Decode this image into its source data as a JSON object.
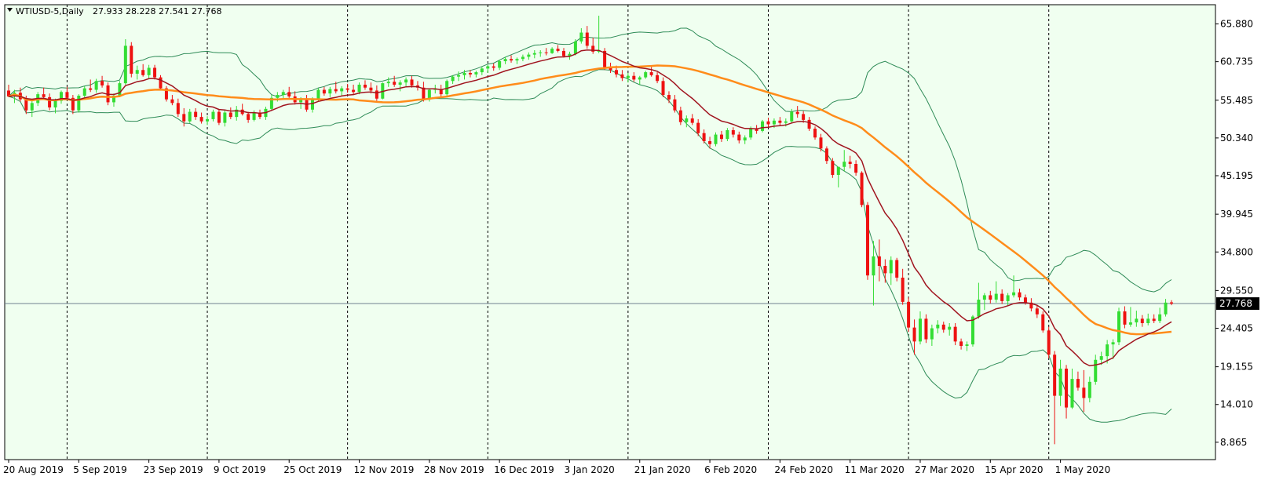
{
  "header": {
    "symbol_timeframe": "WTIUSD-5,Daily",
    "ohlc": "27.933 28.228 27.541 27.768"
  },
  "colors": {
    "background": "#f0fff0",
    "grid": "#000000",
    "bull": "#33dd33",
    "bear": "#ee1111",
    "ma_fast": "#a0141e",
    "ma_slow": "#ff8c1a",
    "bollinger": "#2e8b57",
    "current_price_line": "#708090",
    "price_label_bg": "#000000"
  },
  "chart_data": {
    "type": "candlestick",
    "title": "WTIUSD-5,Daily",
    "ylim": [
      6.5,
      68.5
    ],
    "yticks": [
      "65.880",
      "60.735",
      "55.485",
      "50.340",
      "45.195",
      "39.945",
      "34.800",
      "29.550",
      "24.405",
      "19.155",
      "14.010",
      "8.865"
    ],
    "ytick_values": [
      65.88,
      60.735,
      55.485,
      50.34,
      45.195,
      39.945,
      34.8,
      29.55,
      24.405,
      19.155,
      14.01,
      8.865
    ],
    "xticks": [
      "20 Aug 2019",
      "5 Sep 2019",
      "23 Sep 2019",
      "9 Oct 2019",
      "25 Oct 2019",
      "12 Nov 2019",
      "28 Nov 2019",
      "16 Dec 2019",
      "3 Jan 2020",
      "21 Jan 2020",
      "6 Feb 2020",
      "24 Feb 2020",
      "11 Mar 2020",
      "27 Mar 2020",
      "15 Apr 2020",
      "1 May 2020"
    ],
    "xtick_index": [
      0,
      12,
      24,
      36,
      48,
      60,
      72,
      84,
      96,
      108,
      120,
      132,
      144,
      156,
      168,
      180
    ],
    "separators_index": [
      10,
      34,
      58,
      82,
      106,
      130,
      154,
      178
    ],
    "current_price": 27.768,
    "current_price_label": "27.768",
    "candles": [
      [
        56.8,
        57.6,
        55.9,
        56.0
      ],
      [
        56.0,
        56.9,
        55.1,
        56.5
      ],
      [
        56.5,
        57.2,
        55.3,
        55.6
      ],
      [
        55.6,
        56.1,
        53.6,
        54.1
      ],
      [
        54.1,
        55.4,
        53.2,
        55.1
      ],
      [
        55.1,
        56.6,
        54.7,
        56.3
      ],
      [
        56.3,
        57.2,
        55.6,
        55.9
      ],
      [
        55.9,
        56.4,
        54.1,
        54.5
      ],
      [
        54.5,
        55.7,
        53.7,
        55.4
      ],
      [
        55.4,
        56.8,
        55.0,
        56.6
      ],
      [
        56.6,
        57.3,
        55.5,
        55.8
      ],
      [
        55.8,
        56.2,
        53.6,
        54.1
      ],
      [
        54.1,
        56.3,
        53.8,
        56.1
      ],
      [
        56.1,
        57.4,
        55.7,
        57.1
      ],
      [
        57.1,
        58.3,
        56.6,
        56.9
      ],
      [
        56.9,
        58.4,
        56.5,
        58.1
      ],
      [
        58.1,
        58.8,
        57.2,
        57.5
      ],
      [
        57.5,
        57.9,
        54.8,
        55.2
      ],
      [
        55.2,
        56.4,
        54.6,
        56.1
      ],
      [
        56.1,
        58.1,
        55.9,
        57.8
      ],
      [
        57.8,
        63.8,
        57.6,
        62.9
      ],
      [
        62.9,
        63.4,
        58.6,
        59.1
      ],
      [
        59.1,
        60.2,
        58.3,
        59.6
      ],
      [
        59.6,
        60.4,
        58.7,
        58.9
      ],
      [
        58.9,
        60.3,
        58.4,
        59.9
      ],
      [
        59.9,
        60.3,
        58.3,
        58.6
      ],
      [
        58.6,
        58.9,
        56.8,
        57.1
      ],
      [
        57.1,
        57.4,
        55.3,
        55.6
      ],
      [
        55.6,
        56.2,
        54.8,
        55.1
      ],
      [
        55.1,
        55.7,
        53.2,
        53.6
      ],
      [
        53.6,
        54.4,
        51.9,
        52.6
      ],
      [
        52.6,
        54.3,
        52.4,
        53.9
      ],
      [
        53.9,
        54.4,
        52.8,
        53.2
      ],
      [
        53.2,
        53.8,
        52.3,
        52.6
      ],
      [
        52.6,
        53.3,
        52.1,
        52.9
      ],
      [
        52.9,
        54.2,
        52.6,
        53.9
      ],
      [
        53.9,
        54.3,
        52.1,
        52.4
      ],
      [
        52.4,
        54.1,
        51.9,
        53.8
      ],
      [
        53.8,
        54.5,
        52.9,
        53.2
      ],
      [
        53.2,
        54.7,
        52.7,
        54.2
      ],
      [
        54.2,
        55.0,
        53.4,
        53.6
      ],
      [
        53.6,
        53.9,
        52.4,
        52.8
      ],
      [
        52.8,
        54.1,
        52.6,
        53.8
      ],
      [
        53.8,
        54.2,
        52.9,
        53.2
      ],
      [
        53.2,
        54.6,
        52.8,
        54.3
      ],
      [
        54.3,
        56.2,
        54.1,
        55.8
      ],
      [
        55.8,
        56.6,
        55.3,
        56.2
      ],
      [
        56.2,
        56.9,
        55.6,
        56.6
      ],
      [
        56.6,
        57.3,
        55.8,
        56.0
      ],
      [
        56.0,
        56.7,
        54.9,
        55.2
      ],
      [
        55.2,
        55.9,
        54.3,
        55.5
      ],
      [
        55.5,
        56.2,
        53.9,
        54.2
      ],
      [
        54.2,
        55.9,
        53.8,
        55.6
      ],
      [
        55.6,
        57.1,
        55.3,
        56.9
      ],
      [
        56.9,
        57.3,
        56.1,
        56.4
      ],
      [
        56.4,
        57.3,
        55.9,
        57.0
      ],
      [
        57.0,
        58.0,
        56.4,
        56.7
      ],
      [
        56.7,
        57.4,
        56.0,
        57.1
      ],
      [
        57.1,
        57.7,
        56.5,
        56.9
      ],
      [
        56.9,
        57.6,
        56.2,
        56.6
      ],
      [
        56.6,
        57.9,
        56.3,
        57.6
      ],
      [
        57.6,
        58.2,
        56.9,
        57.2
      ],
      [
        57.2,
        57.9,
        56.4,
        56.8
      ],
      [
        56.8,
        57.5,
        55.4,
        55.7
      ],
      [
        55.7,
        57.9,
        55.6,
        57.8
      ],
      [
        57.8,
        58.6,
        57.3,
        58.0
      ],
      [
        58.0,
        58.8,
        57.3,
        57.6
      ],
      [
        57.6,
        58.2,
        56.7,
        57.9
      ],
      [
        57.9,
        58.6,
        57.4,
        58.3
      ],
      [
        58.3,
        58.8,
        57.2,
        57.5
      ],
      [
        57.5,
        58.1,
        56.8,
        57.2
      ],
      [
        57.2,
        58.0,
        55.3,
        55.6
      ],
      [
        55.6,
        57.1,
        55.3,
        56.9
      ],
      [
        56.9,
        57.6,
        56.4,
        57.0
      ],
      [
        57.0,
        57.6,
        55.9,
        56.3
      ],
      [
        56.3,
        58.3,
        56.0,
        58.1
      ],
      [
        58.1,
        58.9,
        57.7,
        58.7
      ],
      [
        58.7,
        59.4,
        58.1,
        58.9
      ],
      [
        58.9,
        59.6,
        58.3,
        59.2
      ],
      [
        59.2,
        59.6,
        58.6,
        59.0
      ],
      [
        59.0,
        59.5,
        58.6,
        59.3
      ],
      [
        59.3,
        60.0,
        58.9,
        59.8
      ],
      [
        59.8,
        60.3,
        59.2,
        60.1
      ],
      [
        60.1,
        60.5,
        59.5,
        59.9
      ],
      [
        59.9,
        61.0,
        59.6,
        60.8
      ],
      [
        60.8,
        61.4,
        60.4,
        61.1
      ],
      [
        61.1,
        61.6,
        60.6,
        60.9
      ],
      [
        60.9,
        61.3,
        60.4,
        61.1
      ],
      [
        61.1,
        61.7,
        60.8,
        61.4
      ],
      [
        61.4,
        62.0,
        61.0,
        61.7
      ],
      [
        61.7,
        62.3,
        61.2,
        61.9
      ],
      [
        61.9,
        62.3,
        61.4,
        62.0
      ],
      [
        62.0,
        62.6,
        61.6,
        61.9
      ],
      [
        61.9,
        62.7,
        61.8,
        62.5
      ],
      [
        62.5,
        63.0,
        62.0,
        62.2
      ],
      [
        62.2,
        62.6,
        61.3,
        61.5
      ],
      [
        61.5,
        62.1,
        61.0,
        61.8
      ],
      [
        61.8,
        63.8,
        61.6,
        63.5
      ],
      [
        63.5,
        65.3,
        63.2,
        64.7
      ],
      [
        64.7,
        65.6,
        62.5,
        62.9
      ],
      [
        62.9,
        64.0,
        61.8,
        62.1
      ],
      [
        62.1,
        67.0,
        61.9,
        62.2
      ],
      [
        62.2,
        62.6,
        59.6,
        60.0
      ],
      [
        60.0,
        60.6,
        59.2,
        59.6
      ],
      [
        59.6,
        60.2,
        58.6,
        59.0
      ],
      [
        59.0,
        59.6,
        58.1,
        58.5
      ],
      [
        58.5,
        59.2,
        57.9,
        58.8
      ],
      [
        58.8,
        59.3,
        58.0,
        58.3
      ],
      [
        58.3,
        58.8,
        57.6,
        58.6
      ],
      [
        58.6,
        59.5,
        58.4,
        59.3
      ],
      [
        59.3,
        60.0,
        58.7,
        58.9
      ],
      [
        58.9,
        59.3,
        57.8,
        58.1
      ],
      [
        58.1,
        58.6,
        55.9,
        56.2
      ],
      [
        56.2,
        56.7,
        55.1,
        55.6
      ],
      [
        55.6,
        56.2,
        53.8,
        54.1
      ],
      [
        54.1,
        54.6,
        52.1,
        52.5
      ],
      [
        52.5,
        53.4,
        51.8,
        53.0
      ],
      [
        53.0,
        53.6,
        52.1,
        52.4
      ],
      [
        52.4,
        52.9,
        50.6,
        51.0
      ],
      [
        51.0,
        51.5,
        49.6,
        49.9
      ],
      [
        49.9,
        50.5,
        48.9,
        49.5
      ],
      [
        49.5,
        51.1,
        49.2,
        50.8
      ],
      [
        50.8,
        51.3,
        49.8,
        50.2
      ],
      [
        50.2,
        51.7,
        49.9,
        51.4
      ],
      [
        51.4,
        51.8,
        50.4,
        50.8
      ],
      [
        50.8,
        51.2,
        49.6,
        50.0
      ],
      [
        50.0,
        50.7,
        49.5,
        50.4
      ],
      [
        50.4,
        51.9,
        50.1,
        51.6
      ],
      [
        51.6,
        52.1,
        50.9,
        51.3
      ],
      [
        51.3,
        52.8,
        51.1,
        52.6
      ],
      [
        52.6,
        53.1,
        51.8,
        52.2
      ],
      [
        52.2,
        53.0,
        51.7,
        52.7
      ],
      [
        52.7,
        53.2,
        52.0,
        52.4
      ],
      [
        52.4,
        53.0,
        51.9,
        52.6
      ],
      [
        52.6,
        54.3,
        52.4,
        53.9
      ],
      [
        53.9,
        54.7,
        53.1,
        53.6
      ],
      [
        53.6,
        54.0,
        52.4,
        52.8
      ],
      [
        52.8,
        53.2,
        51.3,
        51.6
      ],
      [
        51.6,
        51.9,
        50.1,
        50.4
      ],
      [
        50.4,
        50.9,
        48.5,
        48.9
      ],
      [
        48.9,
        49.2,
        46.8,
        47.2
      ],
      [
        47.2,
        47.6,
        44.9,
        45.3
      ],
      [
        45.3,
        46.1,
        43.6,
        46.4
      ],
      [
        46.4,
        48.7,
        45.8,
        47.1
      ],
      [
        47.1,
        47.9,
        46.2,
        46.8
      ],
      [
        46.8,
        47.3,
        45.2,
        45.6
      ],
      [
        45.6,
        45.8,
        40.9,
        41.2
      ],
      [
        41.2,
        41.6,
        31.0,
        31.6
      ],
      [
        31.6,
        36.3,
        27.5,
        34.2
      ],
      [
        34.2,
        36.5,
        30.8,
        32.9
      ],
      [
        32.9,
        33.8,
        30.6,
        31.9
      ],
      [
        31.9,
        34.2,
        30.3,
        33.7
      ],
      [
        33.7,
        34.0,
        30.8,
        31.3
      ],
      [
        31.3,
        32.5,
        27.6,
        28.0
      ],
      [
        28.0,
        28.6,
        23.9,
        24.5
      ],
      [
        24.5,
        25.6,
        20.8,
        22.6
      ],
      [
        22.6,
        26.7,
        22.2,
        25.7
      ],
      [
        25.7,
        26.3,
        22.4,
        22.9
      ],
      [
        22.9,
        24.9,
        22.0,
        24.4
      ],
      [
        24.4,
        25.5,
        23.7,
        24.9
      ],
      [
        24.9,
        25.3,
        23.8,
        24.2
      ],
      [
        24.2,
        25.1,
        23.4,
        24.6
      ],
      [
        24.6,
        25.1,
        22.1,
        22.6
      ],
      [
        22.6,
        23.0,
        21.5,
        22.0
      ],
      [
        22.0,
        22.6,
        21.3,
        22.2
      ],
      [
        22.2,
        26.2,
        21.9,
        26.0
      ],
      [
        26.0,
        30.6,
        25.7,
        28.3
      ],
      [
        28.3,
        29.2,
        26.9,
        28.9
      ],
      [
        28.9,
        29.5,
        27.8,
        28.3
      ],
      [
        28.3,
        30.8,
        27.9,
        29.1
      ],
      [
        29.1,
        29.7,
        27.7,
        28.1
      ],
      [
        28.1,
        29.2,
        27.4,
        28.9
      ],
      [
        28.9,
        31.6,
        28.6,
        29.3
      ],
      [
        29.3,
        29.8,
        28.2,
        28.6
      ],
      [
        28.6,
        29.0,
        27.6,
        27.9
      ],
      [
        27.9,
        28.5,
        26.7,
        27.1
      ],
      [
        27.1,
        27.6,
        25.8,
        26.3
      ],
      [
        26.3,
        26.7,
        23.8,
        24.1
      ],
      [
        24.1,
        24.6,
        20.3,
        20.8
      ],
      [
        20.8,
        21.3,
        8.6,
        15.2
      ],
      [
        15.2,
        20.1,
        13.8,
        18.9
      ],
      [
        18.9,
        19.4,
        12.1,
        13.6
      ],
      [
        13.6,
        18.9,
        13.4,
        17.5
      ],
      [
        17.5,
        18.5,
        15.9,
        16.3
      ],
      [
        16.3,
        18.7,
        13.0,
        14.9
      ],
      [
        14.9,
        17.8,
        14.3,
        17.1
      ],
      [
        17.1,
        20.8,
        16.7,
        20.1
      ],
      [
        20.1,
        21.2,
        19.4,
        20.6
      ],
      [
        20.6,
        22.8,
        19.6,
        22.2
      ],
      [
        22.2,
        22.9,
        20.2,
        22.5
      ],
      [
        22.5,
        27.2,
        22.1,
        26.7
      ],
      [
        26.7,
        27.4,
        24.4,
        24.9
      ],
      [
        24.9,
        27.3,
        24.6,
        25.2
      ],
      [
        25.2,
        26.8,
        24.6,
        25.7
      ],
      [
        25.7,
        26.2,
        24.6,
        25.1
      ],
      [
        25.1,
        26.4,
        24.8,
        25.7
      ],
      [
        25.7,
        26.3,
        25.1,
        25.4
      ],
      [
        25.4,
        27.2,
        25.1,
        26.3
      ],
      [
        26.3,
        28.4,
        26.0,
        27.9
      ],
      [
        27.933,
        28.228,
        27.541,
        27.768
      ]
    ]
  }
}
